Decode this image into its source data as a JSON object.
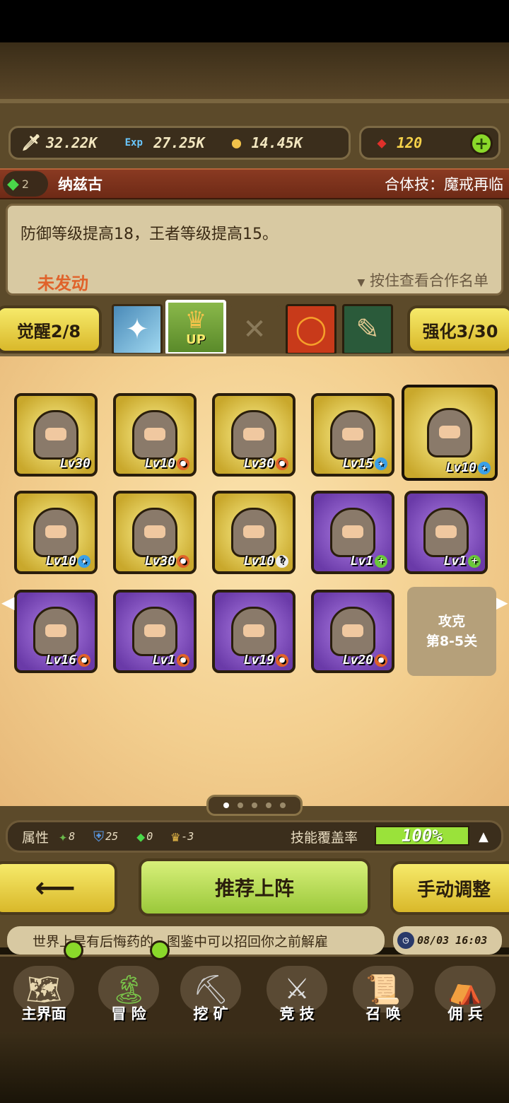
{
  "resources": {
    "attack": "32.22K",
    "exp_label": "Exp",
    "exp": "27.25K",
    "gold": "14.45K",
    "gems": "120"
  },
  "hero": {
    "level": "2",
    "name": "纳兹古",
    "combo_skill": "合体技：魔戒再临"
  },
  "description": {
    "text": "防御等级提高18，王者等级提高15。",
    "status": "未发动",
    "hint": "按住查看合作名单"
  },
  "buttons": {
    "awaken": "觉醒2/8",
    "enhance": "强化3/30",
    "recommend": "推荐上阵",
    "manual": "手动调整"
  },
  "tab_icons": {
    "up_label": "UP"
  },
  "cards": [
    {
      "lv": "Lv30",
      "badge": ""
    },
    {
      "lv": "Lv10",
      "badge": "orange"
    },
    {
      "lv": "Lv30",
      "badge": "orange"
    },
    {
      "lv": "Lv15",
      "badge": "blue"
    },
    {
      "lv": "Lv10",
      "badge": "blue"
    },
    {
      "lv": "Lv10",
      "badge": "blue"
    },
    {
      "lv": "Lv30",
      "badge": "orange"
    },
    {
      "lv": "Lv10",
      "badge": "white"
    },
    {
      "lv": "Lv1",
      "badge": "green"
    },
    {
      "lv": "Lv1",
      "badge": "green"
    },
    {
      "lv": "Lv16",
      "badge": "orange"
    },
    {
      "lv": "Lv1",
      "badge": "orange"
    },
    {
      "lv": "Lv19",
      "badge": "orange"
    },
    {
      "lv": "Lv20",
      "badge": "orange"
    }
  ],
  "locked_slot": {
    "line1": "攻克",
    "line2": "第8-5关"
  },
  "attributes": {
    "label": "属性",
    "a1": "8",
    "a2": "25",
    "a3": "0",
    "a4": "-3",
    "coverage_label": "技能覆盖率",
    "coverage": "100%"
  },
  "ticker": "世界上是有后悔药的，图鉴中可以招回你之前解雇",
  "clock": "08/03 16:03",
  "nav": [
    "主界面",
    "冒 险",
    "挖 矿",
    "竞 技",
    "召 唤",
    "佣 兵"
  ],
  "colors": {
    "accent_gold": "#f6ea6a",
    "accent_green": "#9ae23a",
    "status_orange": "#e0622a"
  }
}
